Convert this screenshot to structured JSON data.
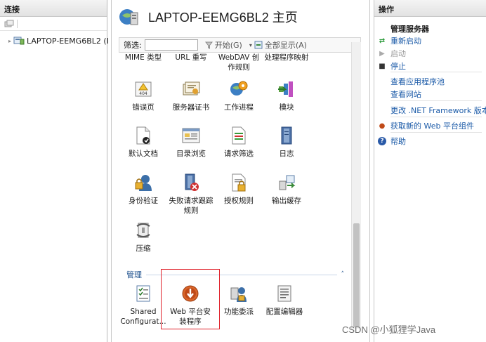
{
  "connections": {
    "header": "连接",
    "tree_item": "LAPTOP-EEMG6BL2 (I"
  },
  "main": {
    "title": "LAPTOP-EEMG6BL2 主页",
    "filter_label": "筛选:",
    "start_label": "开始(G)",
    "show_all_label": "全部显示(A)",
    "cut_labels": [
      "MIME 类型",
      "URL 重写",
      "WebDAV 创作规则",
      "处理程序映射"
    ],
    "features": [
      {
        "name": "error-pages",
        "label": "错误页"
      },
      {
        "name": "server-certificates",
        "label": "服务器证书"
      },
      {
        "name": "worker-processes",
        "label": "工作进程"
      },
      {
        "name": "modules",
        "label": "模块"
      },
      {
        "name": "default-document",
        "label": "默认文档"
      },
      {
        "name": "directory-browsing",
        "label": "目录浏览"
      },
      {
        "name": "request-filtering",
        "label": "请求筛选"
      },
      {
        "name": "logging",
        "label": "日志"
      },
      {
        "name": "authentication",
        "label": "身份验证"
      },
      {
        "name": "failed-request-tracing",
        "label": "失败请求跟踪规则"
      },
      {
        "name": "authorization-rules",
        "label": "授权规则"
      },
      {
        "name": "output-caching",
        "label": "输出缓存"
      },
      {
        "name": "compression",
        "label": "压缩"
      }
    ],
    "management_group": "管理",
    "management": [
      {
        "name": "shared-configuration",
        "label": "Shared Configurat..."
      },
      {
        "name": "web-platform-installer",
        "label": "Web 平台安装程序"
      },
      {
        "name": "feature-delegation",
        "label": "功能委派"
      },
      {
        "name": "configuration-editor",
        "label": "配置编辑器"
      }
    ]
  },
  "actions": {
    "header": "操作",
    "manage_server": "管理服务器",
    "restart": "重新启动",
    "start": "启动",
    "stop": "停止",
    "view_app_pools": "查看应用程序池",
    "view_sites": "查看网站",
    "change_framework": "更改 .NET Framework 版本",
    "get_web_platform": "获取新的 Web 平台组件",
    "help": "帮助"
  },
  "watermark": "CSDN @小狐狸学Java",
  "colors": {
    "link": "#1c5ba8",
    "highlight_border": "#e0212b",
    "group_header": "#1b4f8c"
  }
}
